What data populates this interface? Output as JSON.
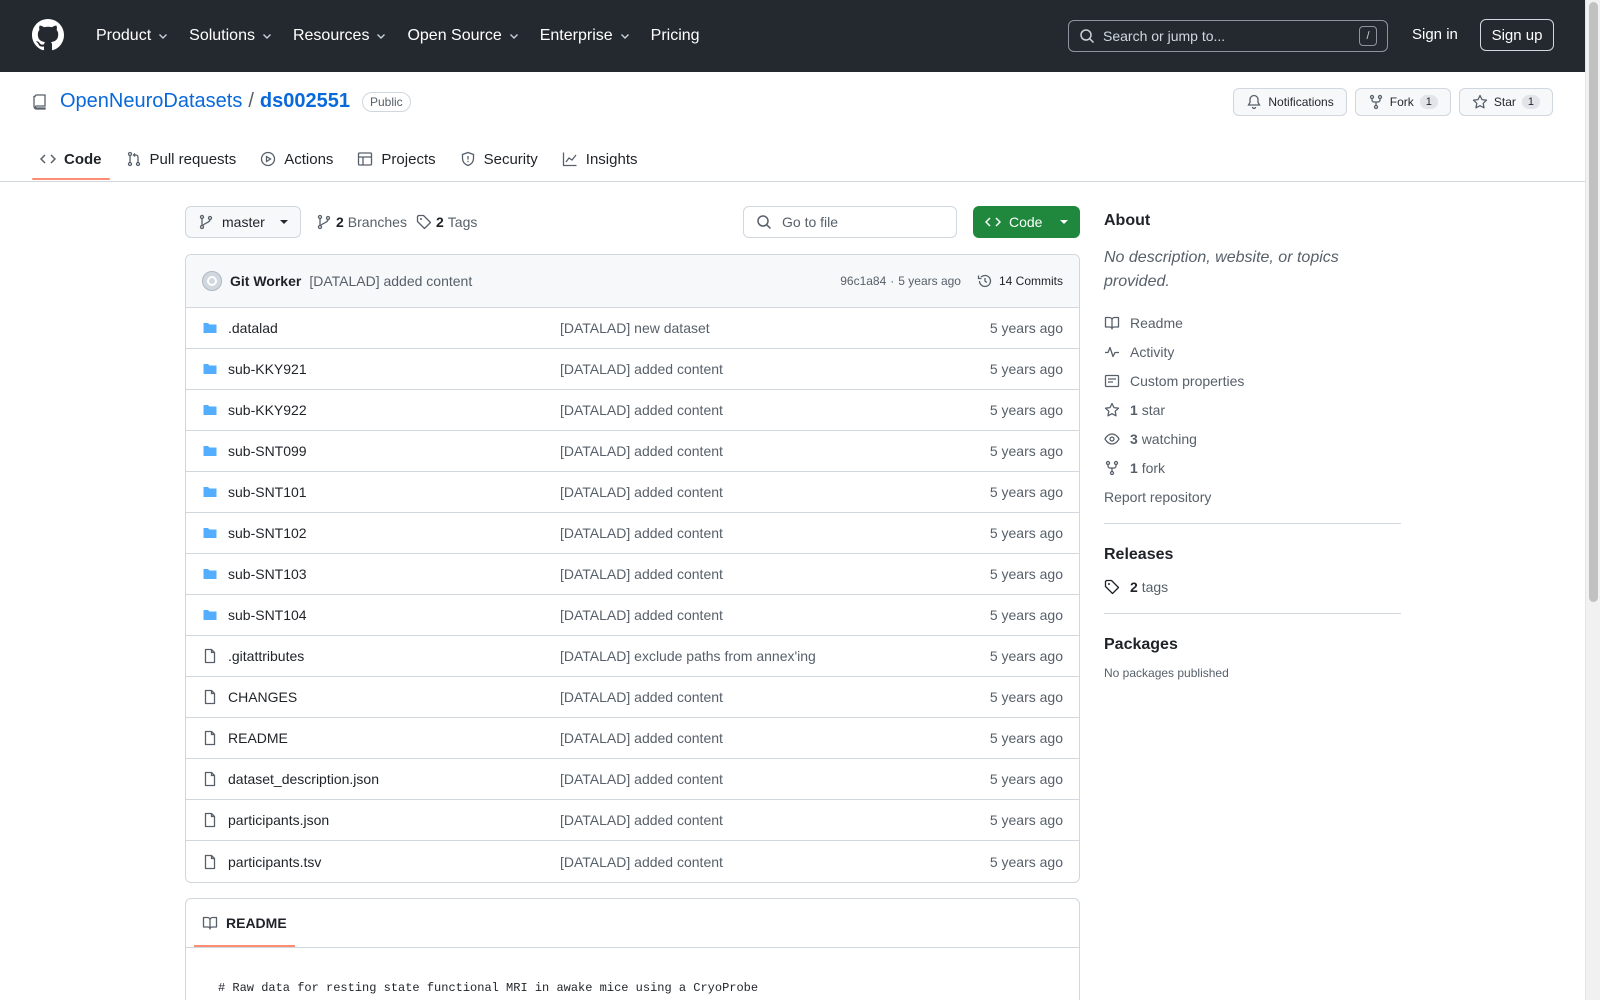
{
  "header": {
    "nav": [
      "Product",
      "Solutions",
      "Resources",
      "Open Source",
      "Enterprise",
      "Pricing"
    ],
    "search_placeholder": "Search or jump to...",
    "search_shortcut": "/",
    "sign_in": "Sign in",
    "sign_up": "Sign up"
  },
  "repo": {
    "owner": "OpenNeuroDatasets",
    "separator": "/",
    "name": "ds002551",
    "visibility": "Public",
    "notifications_label": "Notifications",
    "fork_label": "Fork",
    "fork_count": "1",
    "star_label": "Star",
    "star_count": "1"
  },
  "tabs": [
    {
      "label": "Code",
      "icon": "code-icon",
      "active": true
    },
    {
      "label": "Pull requests",
      "icon": "pull-request-icon"
    },
    {
      "label": "Actions",
      "icon": "play-icon"
    },
    {
      "label": "Projects",
      "icon": "table-icon"
    },
    {
      "label": "Security",
      "icon": "shield-icon"
    },
    {
      "label": "Insights",
      "icon": "graph-icon"
    }
  ],
  "toolbar": {
    "branch": "master",
    "branches_count": "2",
    "branches_label": "Branches",
    "tags_count": "2",
    "tags_label": "Tags",
    "goto_placeholder": "Go to file",
    "code_label": "Code"
  },
  "commit": {
    "author": "Git Worker",
    "message": "[DATALAD] added content",
    "hash": "96c1a84",
    "dot": "·",
    "age": "5 years ago",
    "commits_label": "14 Commits"
  },
  "files": [
    {
      "name": ".datalad",
      "type": "dir",
      "commit": "[DATALAD] new dataset",
      "age": "5 years ago"
    },
    {
      "name": "sub-KKY921",
      "type": "dir",
      "commit": "[DATALAD] added content",
      "age": "5 years ago"
    },
    {
      "name": "sub-KKY922",
      "type": "dir",
      "commit": "[DATALAD] added content",
      "age": "5 years ago"
    },
    {
      "name": "sub-SNT099",
      "type": "dir",
      "commit": "[DATALAD] added content",
      "age": "5 years ago"
    },
    {
      "name": "sub-SNT101",
      "type": "dir",
      "commit": "[DATALAD] added content",
      "age": "5 years ago"
    },
    {
      "name": "sub-SNT102",
      "type": "dir",
      "commit": "[DATALAD] added content",
      "age": "5 years ago"
    },
    {
      "name": "sub-SNT103",
      "type": "dir",
      "commit": "[DATALAD] added content",
      "age": "5 years ago"
    },
    {
      "name": "sub-SNT104",
      "type": "dir",
      "commit": "[DATALAD] added content",
      "age": "5 years ago"
    },
    {
      "name": ".gitattributes",
      "type": "file",
      "commit": "[DATALAD] exclude paths from annex'ing",
      "age": "5 years ago"
    },
    {
      "name": "CHANGES",
      "type": "file",
      "commit": "[DATALAD] added content",
      "age": "5 years ago"
    },
    {
      "name": "README",
      "type": "file",
      "commit": "[DATALAD] added content",
      "age": "5 years ago"
    },
    {
      "name": "dataset_description.json",
      "type": "file",
      "commit": "[DATALAD] added content",
      "age": "5 years ago"
    },
    {
      "name": "participants.json",
      "type": "file",
      "commit": "[DATALAD] added content",
      "age": "5 years ago"
    },
    {
      "name": "participants.tsv",
      "type": "file",
      "commit": "[DATALAD] added content",
      "age": "5 years ago"
    }
  ],
  "readme": {
    "tab_label": "README",
    "first_line": "# Raw data for resting state functional MRI in awake mice using a CryoProbe"
  },
  "sidebar": {
    "about_title": "About",
    "about_desc": "No description, website, or topics provided.",
    "links": [
      {
        "icon": "book-icon",
        "label": "Readme"
      },
      {
        "icon": "pulse-icon",
        "label": "Activity"
      },
      {
        "icon": "note-icon",
        "label": "Custom properties"
      },
      {
        "icon": "star-icon",
        "count": "1",
        "label": "star"
      },
      {
        "icon": "eye-icon",
        "count": "3",
        "label": "watching"
      },
      {
        "icon": "fork-icon",
        "count": "1",
        "label": "fork"
      }
    ],
    "report": "Report repository",
    "releases_title": "Releases",
    "tags_count": "2",
    "tags_label": "tags",
    "packages_title": "Packages",
    "no_packages": "No packages published"
  },
  "colors": {
    "header_bg": "#24292f",
    "link": "#0969da",
    "primary_button": "#1f883d",
    "folder": "#54aeff",
    "tab_underline": "#fd8c73"
  }
}
